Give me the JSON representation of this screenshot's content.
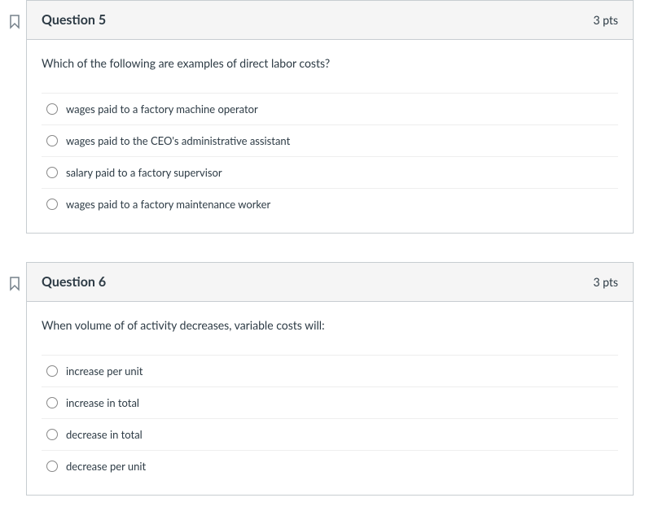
{
  "questions": [
    {
      "title": "Question 5",
      "points": "3 pts",
      "prompt": "Which of the following are examples of direct labor costs?",
      "answers": [
        "wages paid to a factory machine operator",
        "wages paid to the CEO's administrative assistant",
        "salary paid to a factory supervisor",
        "wages paid to a factory maintenance worker"
      ]
    },
    {
      "title": "Question 6",
      "points": "3 pts",
      "prompt": "When volume of of activity decreases, variable costs will:",
      "answers": [
        "increase per unit",
        "increase in total",
        "decrease in total",
        "decrease per unit"
      ]
    }
  ]
}
